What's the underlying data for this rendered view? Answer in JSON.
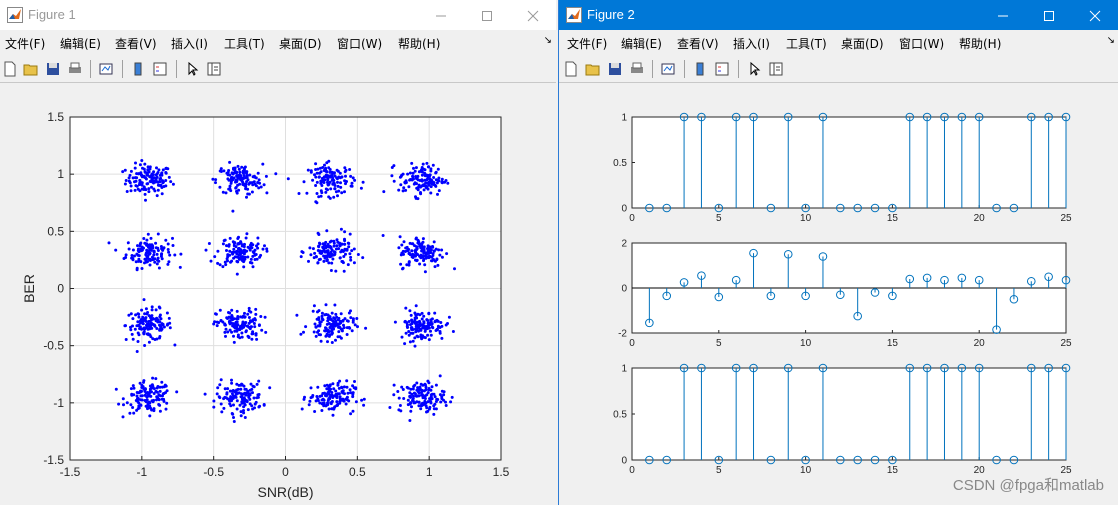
{
  "colors": {
    "accent": "#0078d7",
    "scatter_dot": "#0000ff",
    "stem": "#0072bd"
  },
  "watermark": "CSDN @fpga和matlab",
  "window1": {
    "title": "Figure 1",
    "menu": [
      "文件(F)",
      "编辑(E)",
      "查看(V)",
      "插入(I)",
      "工具(T)",
      "桌面(D)",
      "窗口(W)",
      "帮助(H)"
    ],
    "toolbar_icons": [
      "new-figure-icon",
      "open-file-icon",
      "save-icon",
      "print-icon",
      "link-plot-icon",
      "colorbar-icon",
      "legend-icon",
      "pointer-icon",
      "property-inspector-icon"
    ],
    "chart_data": {
      "type": "scatter",
      "xlabel": "SNR(dB)",
      "ylabel": "BER",
      "xlim": [
        -1.5,
        1.5
      ],
      "ylim": [
        -1.5,
        1.5
      ],
      "xticks": [
        "-1.5",
        "-1",
        "-0.5",
        "0",
        "0.5",
        "1",
        "1.5"
      ],
      "yticks": [
        "1.5",
        "1",
        "0.5",
        "0",
        "-0.5",
        "-1",
        "-1.5"
      ],
      "grid": true,
      "cluster_centers_x": [
        -0.95,
        -0.32,
        0.32,
        0.95
      ],
      "cluster_centers_y": [
        0.95,
        0.32,
        -0.32,
        -0.95
      ],
      "cluster_spread": 0.08,
      "points_per_cluster": 130
    }
  },
  "window2": {
    "title": "Figure 2",
    "menu": [
      "文件(F)",
      "编辑(E)",
      "查看(V)",
      "插入(I)",
      "工具(T)",
      "桌面(D)",
      "窗口(W)",
      "帮助(H)"
    ],
    "toolbar_icons": [
      "new-figure-icon",
      "open-file-icon",
      "save-icon",
      "print-icon",
      "link-plot-icon",
      "colorbar-icon",
      "legend-icon",
      "pointer-icon",
      "property-inspector-icon"
    ],
    "chart_data": [
      {
        "type": "stem",
        "x": [
          1,
          2,
          3,
          4,
          5,
          6,
          7,
          8,
          9,
          10,
          11,
          12,
          13,
          14,
          15,
          16,
          17,
          18,
          19,
          20,
          21,
          22,
          23,
          24,
          25
        ],
        "values": [
          0,
          0,
          1,
          1,
          0,
          1,
          1,
          0,
          1,
          0,
          1,
          0,
          0,
          0,
          0,
          1,
          1,
          1,
          1,
          1,
          0,
          0,
          1,
          1,
          1
        ],
        "xlim": [
          0,
          25
        ],
        "ylim": [
          0,
          1
        ],
        "xticks": [
          "0",
          "5",
          "10",
          "15",
          "20",
          "25"
        ],
        "yticks": [
          "1",
          "0.5",
          "0"
        ]
      },
      {
        "type": "stem",
        "x": [
          1,
          2,
          3,
          4,
          5,
          6,
          7,
          8,
          9,
          10,
          11,
          12,
          13,
          14,
          15,
          16,
          17,
          18,
          19,
          20,
          21,
          22,
          23,
          24,
          25
        ],
        "values": [
          -1.55,
          -0.35,
          0.25,
          0.55,
          -0.4,
          0.35,
          1.55,
          -0.35,
          1.5,
          -0.35,
          1.4,
          -0.3,
          -1.25,
          -0.2,
          -0.35,
          0.4,
          0.45,
          0.35,
          0.45,
          0.35,
          -1.85,
          -0.5,
          0.3,
          0.5,
          0.35
        ],
        "xlim": [
          0,
          25
        ],
        "ylim": [
          -2,
          2
        ],
        "xticks": [
          "0",
          "5",
          "10",
          "15",
          "20",
          "25"
        ],
        "yticks": [
          "2",
          "0",
          "-2"
        ]
      },
      {
        "type": "stem",
        "x": [
          1,
          2,
          3,
          4,
          5,
          6,
          7,
          8,
          9,
          10,
          11,
          12,
          13,
          14,
          15,
          16,
          17,
          18,
          19,
          20,
          21,
          22,
          23,
          24,
          25
        ],
        "values": [
          0,
          0,
          1,
          1,
          0,
          1,
          1,
          0,
          1,
          0,
          1,
          0,
          0,
          0,
          0,
          1,
          1,
          1,
          1,
          1,
          0,
          0,
          1,
          1,
          1
        ],
        "xlim": [
          0,
          25
        ],
        "ylim": [
          0,
          1
        ],
        "xticks": [
          "0",
          "5",
          "10",
          "15",
          "20",
          "25"
        ],
        "yticks": [
          "1",
          "0.5",
          "0"
        ]
      }
    ]
  }
}
